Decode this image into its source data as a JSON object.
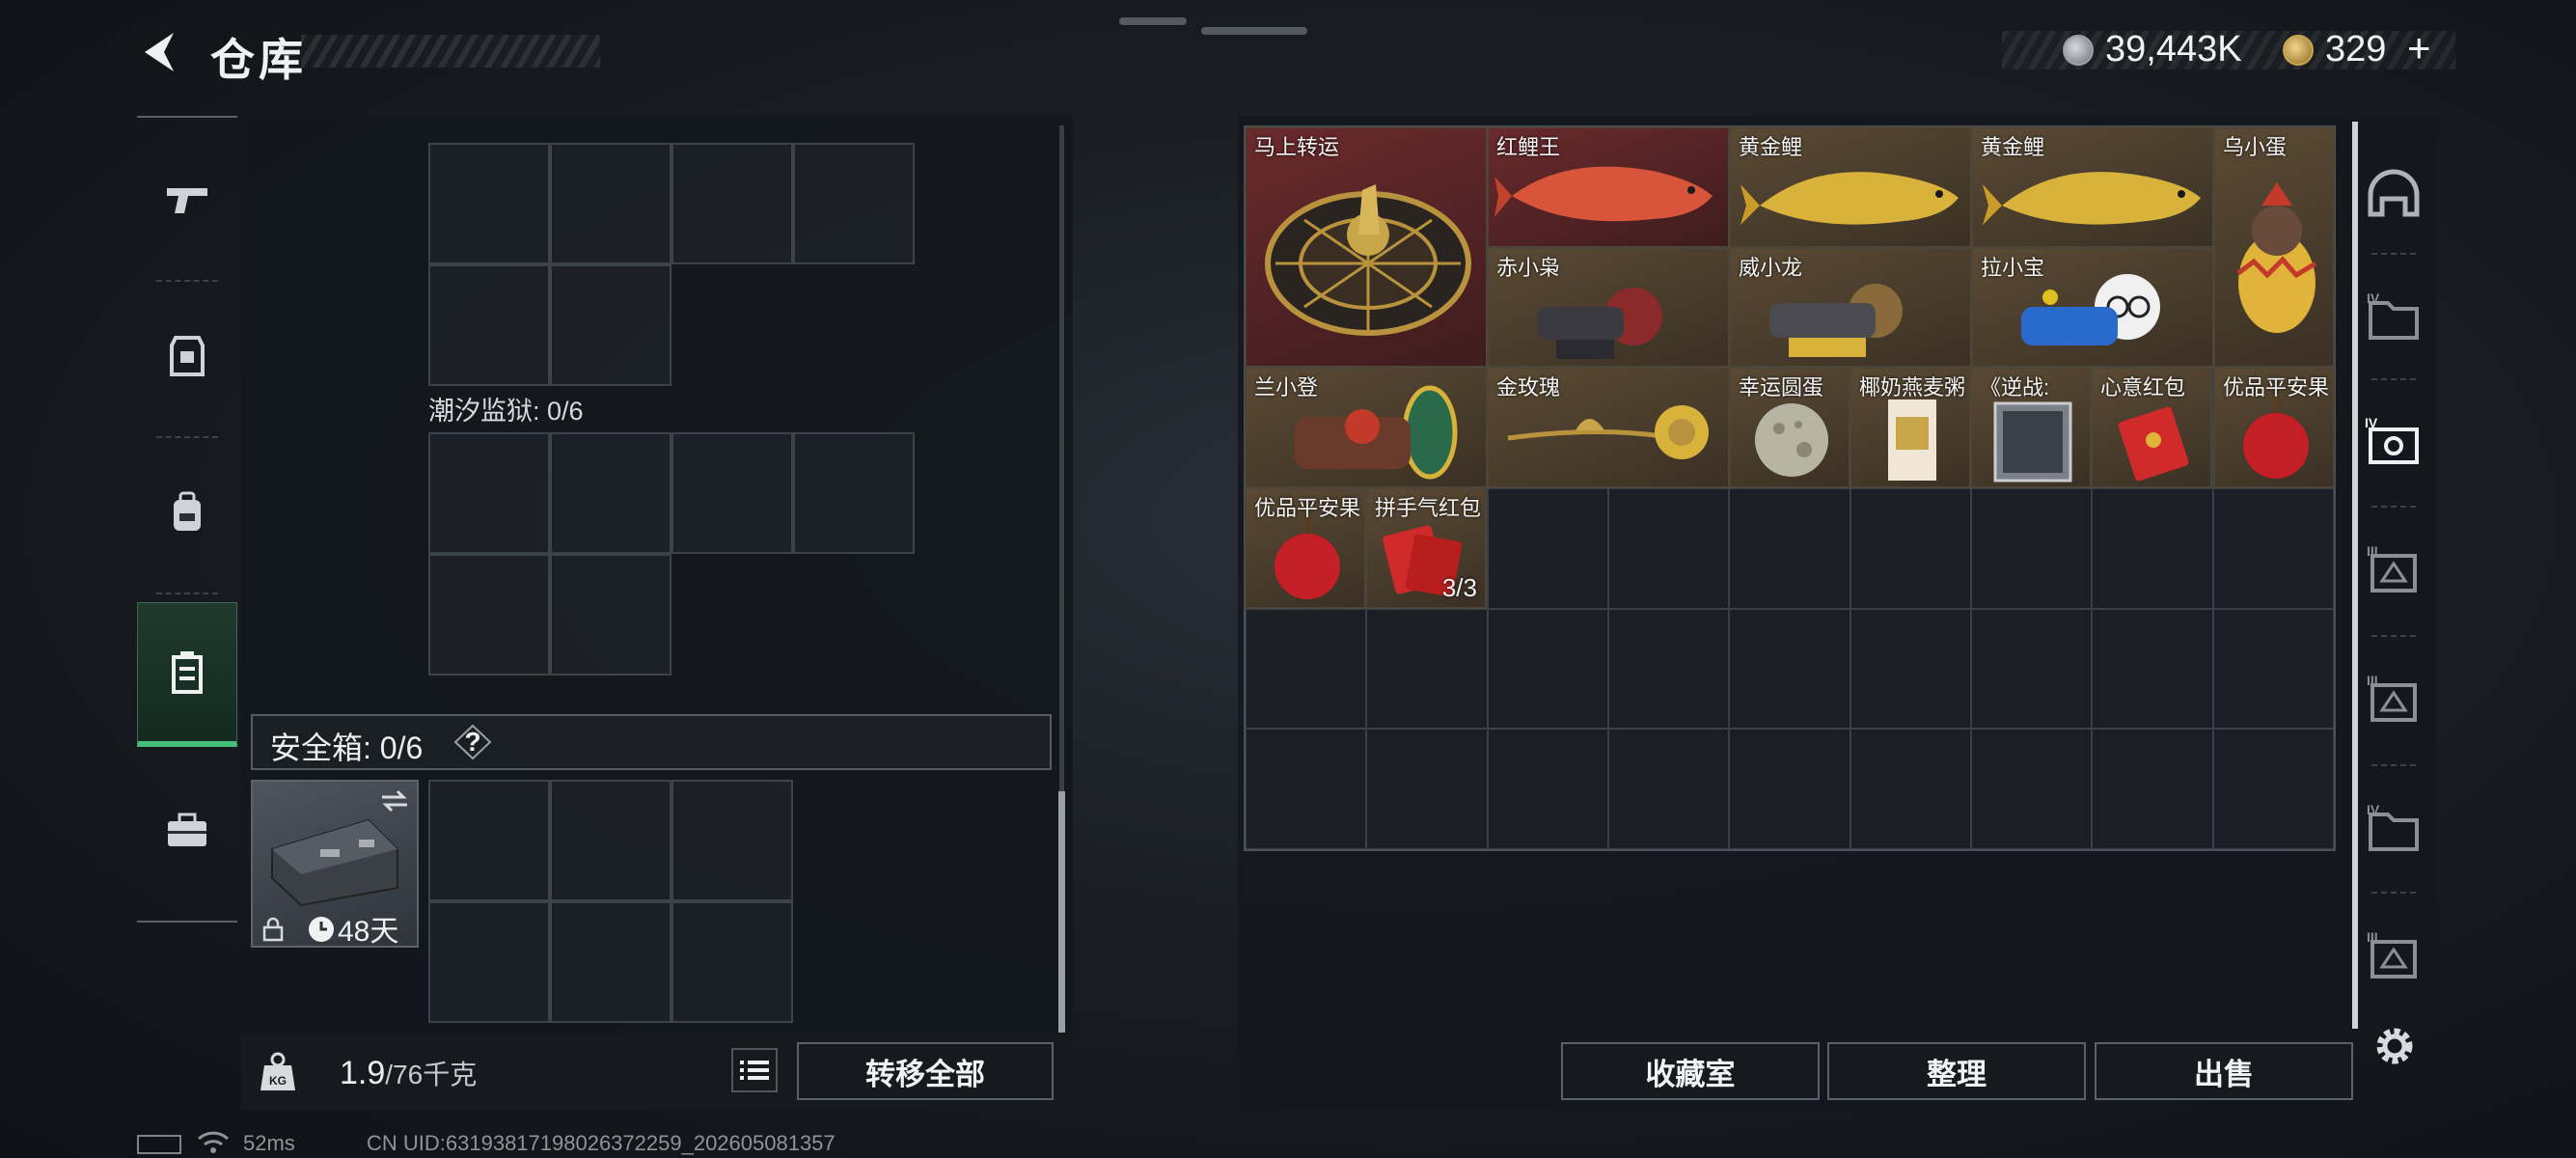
{
  "header": {
    "title": "仓库",
    "currency1": "39,443K",
    "currency2": "329",
    "currency2_plus": "+"
  },
  "left_nav": {
    "items": [
      "gun-icon",
      "armor-icon",
      "backpack-icon",
      "container-icon",
      "toolbox-icon"
    ],
    "active_index": 3
  },
  "containers": [
    {
      "label": "潮汐监狱: 0/6"
    }
  ],
  "safebox": {
    "label": "安全箱: 0/6",
    "help": "?",
    "days": "48天"
  },
  "bottom_left": {
    "weight_value": "1.9",
    "weight_max": "/76千克",
    "transfer_all": "转移全部"
  },
  "inventory": {
    "items": [
      {
        "name": "马上转运",
        "count": ""
      },
      {
        "name": "红鲤王",
        "count": ""
      },
      {
        "name": "黄金鲤",
        "count": ""
      },
      {
        "name": "黄金鲤",
        "count": ""
      },
      {
        "name": "乌小蛋",
        "count": ""
      },
      {
        "name": "赤小枭",
        "count": ""
      },
      {
        "name": "威小龙",
        "count": ""
      },
      {
        "name": "拉小宝",
        "count": ""
      },
      {
        "name": "兰小登",
        "count": ""
      },
      {
        "name": "金玫瑰",
        "count": ""
      },
      {
        "name": "幸运圆蛋",
        "count": ""
      },
      {
        "name": "椰奶燕麦粥",
        "count": ""
      },
      {
        "name": "《逆战:",
        "count": ""
      },
      {
        "name": "心意红包",
        "count": ""
      },
      {
        "name": "优品平安果",
        "count": ""
      },
      {
        "name": "优品平安果",
        "count": ""
      },
      {
        "name": "拼手气红包",
        "count": "3/3"
      }
    ]
  },
  "bottom_right": {
    "collection_room": "收藏室",
    "organize": "整理",
    "sell": "出售"
  },
  "right_rail": {
    "tabs": [
      "helmet-icon",
      "folder-iv-icon",
      "box-iv-icon",
      "box-iii-icon",
      "box-iii-icon",
      "folder-iv-icon",
      "box-iii-icon"
    ],
    "active_index": 2
  },
  "footer": {
    "ping": "52ms",
    "uid": "CN UID:63193817198026372259_202605081357"
  },
  "colors": {
    "accent_green": "#45c07a",
    "quality_red": "#6a2a2c",
    "quality_gold": "#5a4a34"
  }
}
